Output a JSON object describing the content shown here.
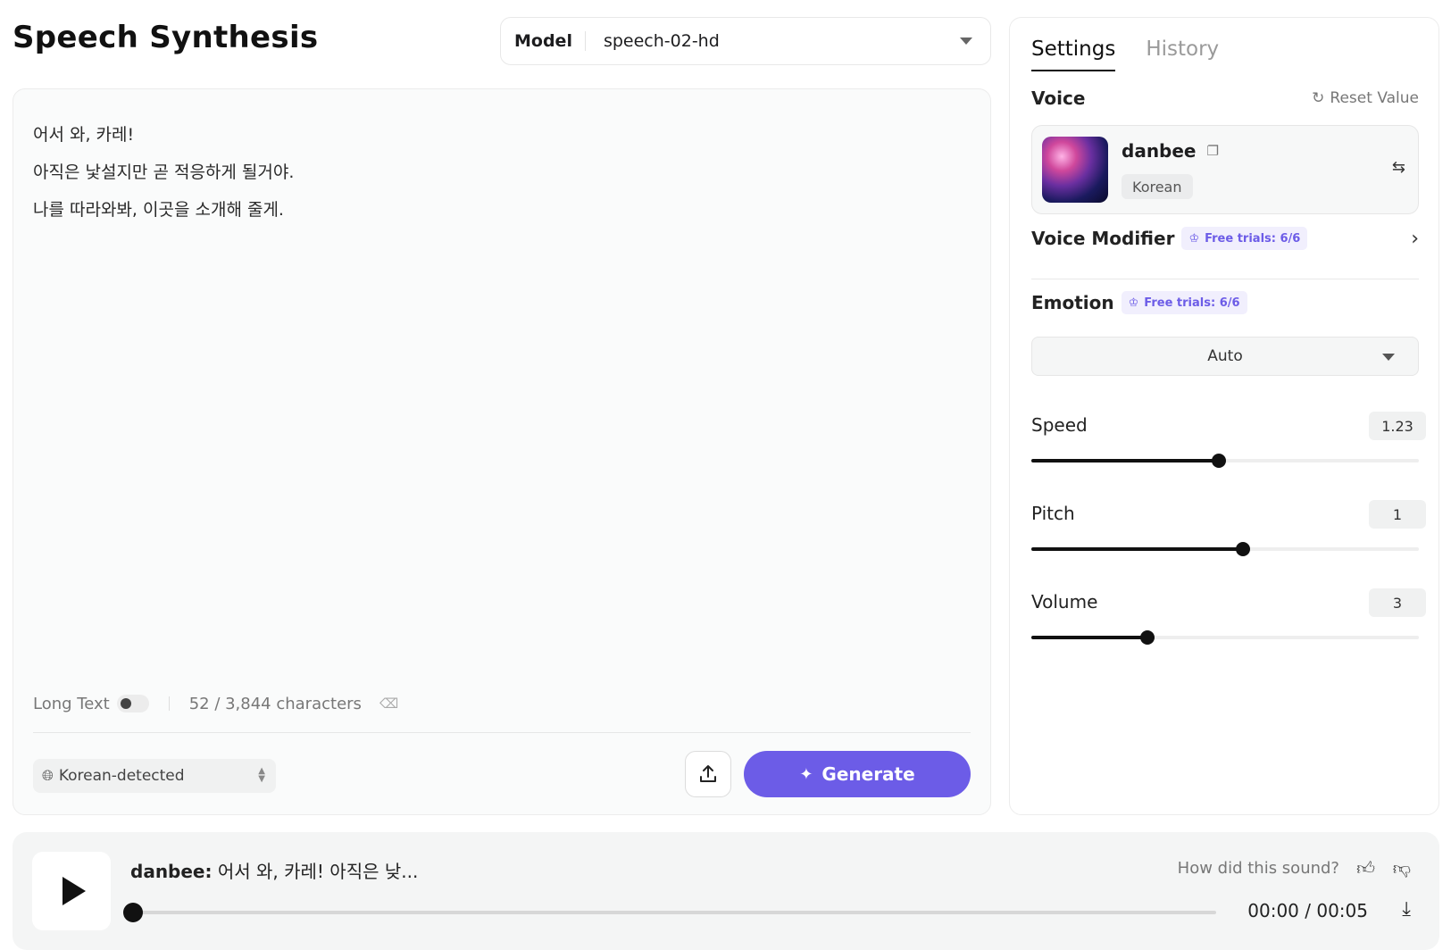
{
  "page": {
    "title": "Speech Synthesis"
  },
  "model": {
    "label": "Model",
    "value": "speech-02-hd"
  },
  "editor": {
    "lines": [
      "어서 와, 카레!",
      "아직은 낯설지만 곧 적응하게 될거야.",
      "나를 따라와봐, 이곳을 소개해 줄게."
    ],
    "long_text_label": "Long Text",
    "long_text_enabled": false,
    "char_count": "52 / 3,844 characters",
    "language": "Korean-detected",
    "generate_label": "Generate"
  },
  "panel": {
    "tabs": [
      {
        "label": "Settings",
        "active": true
      },
      {
        "label": "History",
        "active": false
      }
    ],
    "voice_title": "Voice",
    "reset_label": "Reset Value",
    "voice": {
      "name": "danbee",
      "language": "Korean"
    },
    "voice_modifier": {
      "title": "Voice Modifier",
      "badge": "Free trials: 6/6"
    },
    "emotion": {
      "title": "Emotion",
      "badge": "Free trials: 6/6",
      "value": "Auto"
    },
    "speed": {
      "label": "Speed",
      "value": "1.23",
      "fill_pct": 48.5
    },
    "pitch": {
      "label": "Pitch",
      "value": "1",
      "fill_pct": 54.5
    },
    "volume": {
      "label": "Volume",
      "value": "3",
      "fill_pct": 30
    }
  },
  "player": {
    "voice": "danbee:",
    "snippet": " 어서 와, 카레! 아직은 낮...",
    "feedback_prompt": "How did this sound?",
    "time": "00:00 / 00:05",
    "progress_pct": 0
  },
  "colors": {
    "accent": "#6c5ce7",
    "badge_bg": "#f1effd"
  },
  "icons": {
    "globe": "globe-icon",
    "upload": "upload-icon",
    "sparkle": "sparkle-icon",
    "reset": "reset-icon",
    "copy": "copy-icon",
    "swap": "swap-icon",
    "crown": "crown-icon",
    "chevron": "chevron-right-icon",
    "play": "play-icon",
    "thumbs_up": "thumbs-up-icon",
    "thumbs_down": "thumbs-down-icon",
    "download": "download-icon",
    "eraser": "eraser-icon"
  }
}
